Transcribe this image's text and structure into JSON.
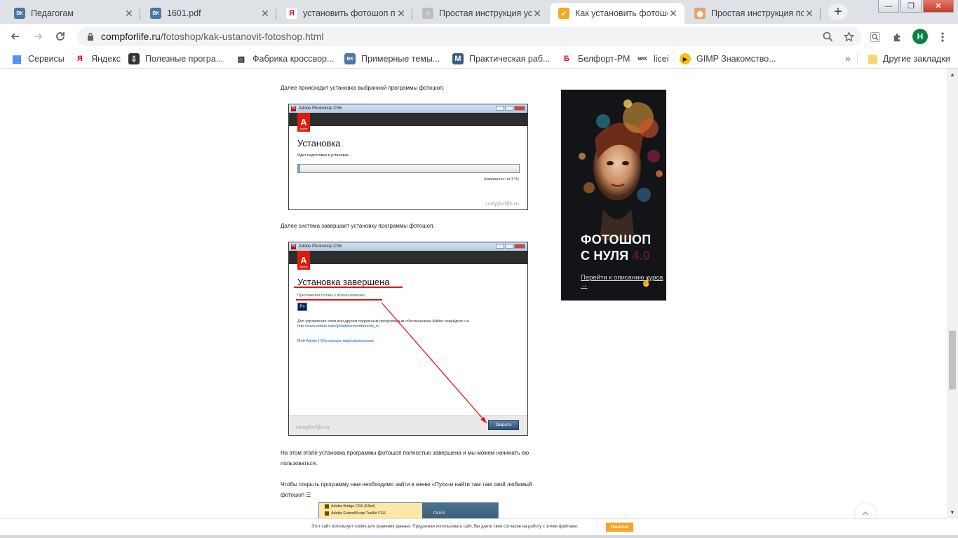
{
  "browser": {
    "tabs": [
      {
        "title": "Педагогам",
        "favicon": "vk-icon",
        "color": "#4a76a8",
        "glyph": "ВК"
      },
      {
        "title": "1601.pdf",
        "favicon": "vk-icon",
        "color": "#4a76a8",
        "glyph": "ВК"
      },
      {
        "title": "установить фотошоп по",
        "favicon": "yandex-icon",
        "color": "#ffffff",
        "glyph": "Я"
      },
      {
        "title": "Простая инструкция ус",
        "favicon": "site-icon",
        "color": "#bdbdbd",
        "glyph": "○"
      },
      {
        "title": "Как установить фотошо",
        "favicon": "compforlife-icon",
        "color": "#f5a623",
        "glyph": "✓",
        "active": true
      },
      {
        "title": "Простая инструкция по",
        "favicon": "site-icon",
        "color": "#e8a36b",
        "glyph": "◉"
      }
    ],
    "new_tab": "+",
    "window_controls": {
      "minimize": "—",
      "maximize": "❐",
      "close": "✕"
    },
    "url_domain": "compforlife.ru",
    "url_path": "/fotoshop/kak-ustanovit-fotoshop.html",
    "profile_initial": "H",
    "bookmarks": [
      {
        "label": "Сервисы",
        "icon": "apps-grid-icon",
        "color": "#4285f4",
        "glyph": "▦"
      },
      {
        "label": "Яндекс",
        "icon": "yandex-icon",
        "color": "#ffffff",
        "glyph": "Я"
      },
      {
        "label": "Полезные програ...",
        "icon": "download-icon",
        "color": "#333333",
        "glyph": "⇩"
      },
      {
        "label": "Фабрика кроссвор...",
        "icon": "crossword-icon",
        "color": "#ffffff",
        "glyph": "▧"
      },
      {
        "label": "Примерные темы...",
        "icon": "vk-icon",
        "color": "#4a76a8",
        "glyph": "ВК"
      },
      {
        "label": "Практическая раб...",
        "icon": "m-icon",
        "color": "#3d5a80",
        "glyph": "M"
      },
      {
        "label": "Белфорт-РМ",
        "icon": "belfort-icon",
        "color": "#ffffff",
        "glyph": "Б"
      },
      {
        "label": "licei",
        "icon": "wix-icon",
        "color": "#ffffff",
        "glyph": "WIX"
      },
      {
        "label": "GIMP Знакомство...",
        "icon": "gimp-icon",
        "color": "#f4c20d",
        "glyph": "▶"
      }
    ],
    "bookmarks_more": "»",
    "other_bookmarks": "Другие закладки"
  },
  "article": {
    "p1": "Далее происходит установка выбранной программы фотошоп.",
    "p2": "Далее система завершает установку программы фотошоп.",
    "p3": "На этом этапе установка программы фотошоп полностью завершена и мы можем начинать ею пользоваться.",
    "p4": "Чтобы открыть программу нам необходимо зайти в меню «Пуск»и найти там там свой любимый фотошоп ☰"
  },
  "shot1": {
    "window_title": "Adobe Photoshop CS6",
    "adobe": "Adobe",
    "heading": "Установка",
    "sub": "Идет подготовка к установке...",
    "progress_fraction": 0.01,
    "percent_text": "(завершено на 1 %)",
    "watermark": "compforlife.ru"
  },
  "shot2": {
    "window_title": "Adobe Photoshop CS6",
    "adobe": "Adobe",
    "heading": "Установка завершена",
    "sub": "Приложения готовы к использованию",
    "ps_icon": "Ps",
    "info": "Для управления этим или другим подписным программным обеспечением Adobe перейдите на",
    "info_link": "http://www.adobe.com/go/adobemembership_ru",
    "link1": "Мой Adobe",
    "link_sep": "|",
    "link2": "Обучающие видеоматериалы",
    "close_button": "Закрыть",
    "watermark": "compforlife.ru"
  },
  "startmenu": {
    "items": [
      "Adobe Bridge CS6 (64bit)",
      "Adobe ExtendScript Toolkit CS6"
    ],
    "user": "OLEG"
  },
  "ad": {
    "line1": "ФОТОШОП",
    "line2": "С НУЛЯ",
    "version": "4.0",
    "cta": "Перейти к описанию курса →"
  },
  "cookie": {
    "text": "Этот сайт использует cookie для хранения данных. Продолжая использовать сайт, Вы даете свое согласие на работу с этими файлами.",
    "button": "Понятно"
  },
  "colors": {
    "accent_red": "#e0141a",
    "adobe_red": "#e01a0b",
    "cookie_button": "#f5a623",
    "profile": "#0b8043"
  }
}
